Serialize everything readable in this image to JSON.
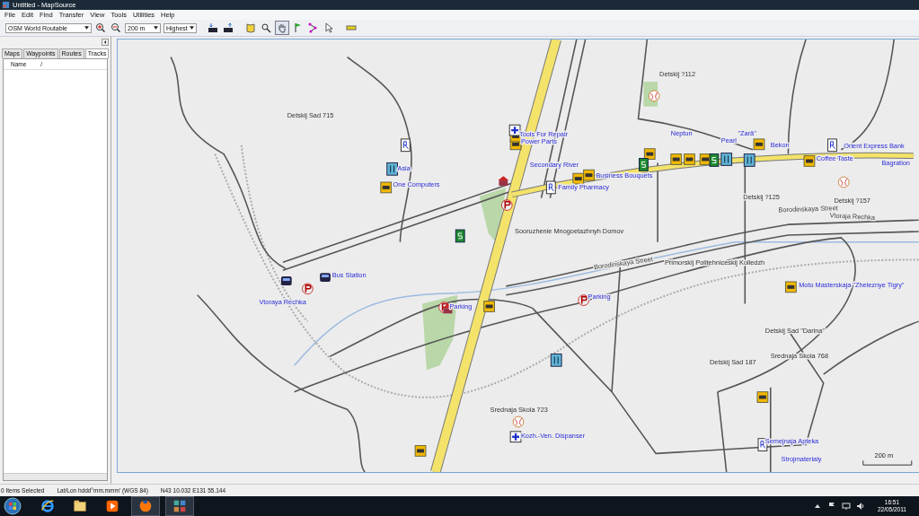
{
  "window": {
    "title": "Untitled - MapSource"
  },
  "menu": [
    "File",
    "Edit",
    "Find",
    "Transfer",
    "View",
    "Tools",
    "Utilities",
    "Help"
  ],
  "toolbar": {
    "map_product": "OSM World Routable",
    "zoom_scale": "200 m",
    "detail": "Highest"
  },
  "sidebar": {
    "tabs": [
      {
        "label": "Maps",
        "selected": false
      },
      {
        "label": "Waypoints",
        "selected": false
      },
      {
        "label": "Routes",
        "selected": false
      },
      {
        "label": "Tracks",
        "selected": true
      }
    ],
    "columns": [
      "Name",
      "/"
    ]
  },
  "map": {
    "labels": [
      {
        "text": "Tools For Repair",
        "kind": "poi"
      },
      {
        "text": "Power Parts",
        "kind": "poi"
      },
      {
        "text": "Secondary River",
        "kind": "poi"
      },
      {
        "text": "Business Bouquets",
        "kind": "poi"
      },
      {
        "text": "Family Pharmacy",
        "kind": "poi"
      },
      {
        "text": "Asia",
        "kind": "poi"
      },
      {
        "text": "One Computers",
        "kind": "poi"
      },
      {
        "text": "Parking",
        "kind": "poi"
      },
      {
        "text": "Neptun",
        "kind": "poi"
      },
      {
        "text": "Pearl",
        "kind": "poi"
      },
      {
        "text": "\"Zarä\"",
        "kind": "poi"
      },
      {
        "text": "Bekon",
        "kind": "poi"
      },
      {
        "text": "Orient Express Bank",
        "kind": "poi"
      },
      {
        "text": "Coffee Taste",
        "kind": "poi"
      },
      {
        "text": "Bagration",
        "kind": "poi"
      },
      {
        "text": "Bus Station",
        "kind": "poi"
      },
      {
        "text": "Vtoraya Rechka",
        "kind": "poi"
      },
      {
        "text": "Moto Masterskaja \"Zheleznye Tigry\"",
        "kind": "poi"
      },
      {
        "text": "Kozh.-Ven. Dispanser",
        "kind": "poi"
      },
      {
        "text": "Semejnaja Apteka",
        "kind": "poi"
      },
      {
        "text": "Strojmaterialy",
        "kind": "poi"
      },
      {
        "text": "Parking",
        "kind": "poi"
      },
      {
        "text": "Detskij Sad 715",
        "kind": "place"
      },
      {
        "text": "Detskij ?112",
        "kind": "place"
      },
      {
        "text": "Sooruzhenie Mnogoetazhnyh Domov",
        "kind": "place"
      },
      {
        "text": "Detskij ?125",
        "kind": "place"
      },
      {
        "text": "Detskij ?157",
        "kind": "place"
      },
      {
        "text": "Primorskij Politehniceskij Kolledzh",
        "kind": "place"
      },
      {
        "text": "Detskij Sad \"Darina\"",
        "kind": "place"
      },
      {
        "text": "Detskij Sad 187",
        "kind": "place"
      },
      {
        "text": "Srednaja Skola 768",
        "kind": "place"
      },
      {
        "text": "Srednaja Skola 723",
        "kind": "place"
      },
      {
        "text": "Borodinskaya Street",
        "kind": "street"
      },
      {
        "text": "Vtoraja Rechka",
        "kind": "street"
      },
      {
        "text": "Borodinskaya Street",
        "kind": "street"
      }
    ],
    "scale": "200 m"
  },
  "status_bar": {
    "selection": "0 Items Selected",
    "format": "Lat/Lon hddd°mm.mmm' (WGS 84)",
    "position": "N43 10.032 E131 55.144"
  },
  "taskbar": {
    "time": "16:51",
    "date": "22/05/2011"
  }
}
